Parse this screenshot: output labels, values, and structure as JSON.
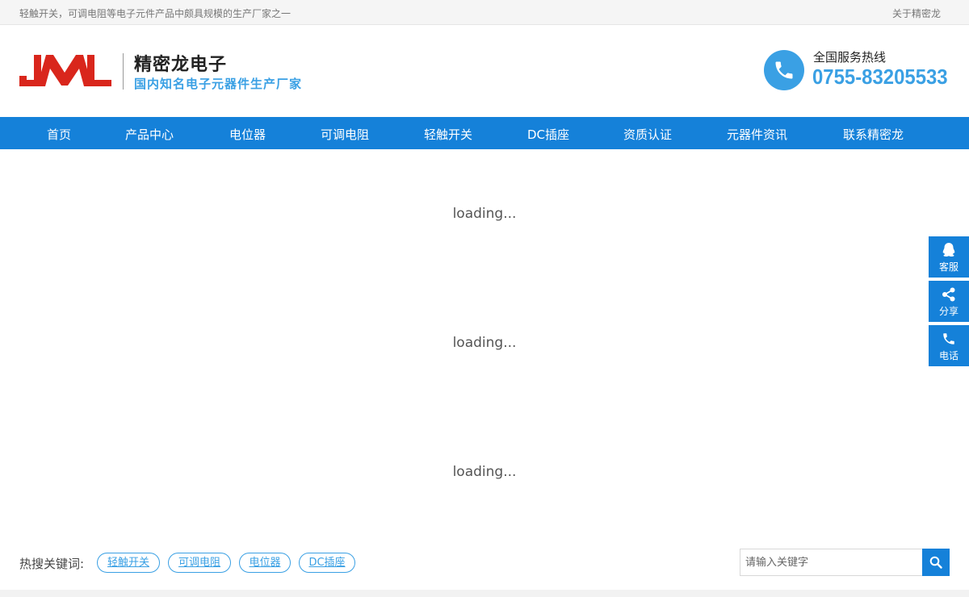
{
  "topbar": {
    "slogan": "轻触开关，可调电阻等电子元件产品中颇具规模的生产厂家之一",
    "about_link": "关于精密龙"
  },
  "header": {
    "logo_text": "JML",
    "brand_name": "精密龙电子",
    "brand_tagline": "国内知名电子元器件生产厂家",
    "hotline_label": "全国服务热线",
    "hotline_number": "0755-83205533",
    "hotline_icon": "phone-icon"
  },
  "nav": {
    "items": [
      {
        "label": "首页"
      },
      {
        "label": "产品中心"
      },
      {
        "label": "电位器"
      },
      {
        "label": "可调电阻"
      },
      {
        "label": "轻触开关"
      },
      {
        "label": "DC插座"
      },
      {
        "label": "资质认证"
      },
      {
        "label": "元器件资讯"
      },
      {
        "label": "联系精密龙"
      }
    ]
  },
  "main": {
    "loading_text": [
      "loading...",
      "loading...",
      "loading..."
    ]
  },
  "float_bar": {
    "items": [
      {
        "label": "客服",
        "icon": "qq-icon"
      },
      {
        "label": "分享",
        "icon": "share-icon"
      },
      {
        "label": "电话",
        "icon": "phone-icon"
      }
    ]
  },
  "search": {
    "hot_label": "热搜关键词:",
    "tags": [
      "轻触开关",
      "可调电阻",
      "电位器",
      "DC插座"
    ],
    "placeholder": "请输入关键字",
    "button_icon": "search-icon"
  },
  "colors": {
    "primary": "#1581d9",
    "accent": "#3aa0e4",
    "logo_red": "#d9261c"
  }
}
